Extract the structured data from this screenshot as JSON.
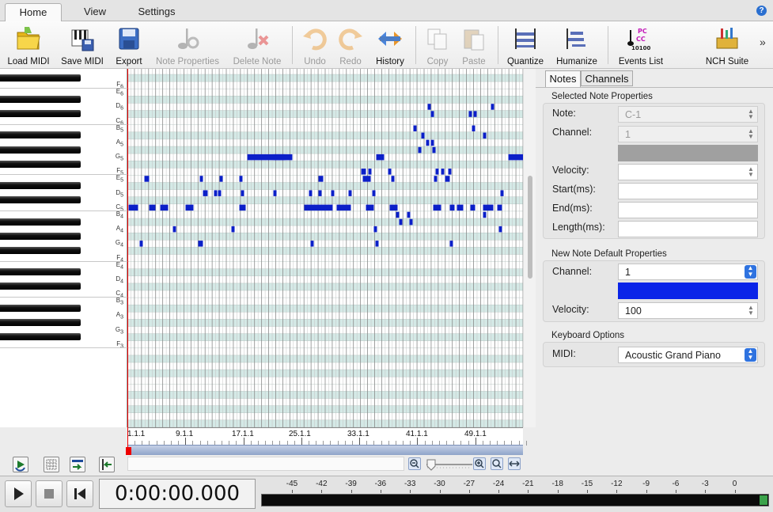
{
  "menu": {
    "tabs": [
      "Home",
      "View",
      "Settings"
    ],
    "help": "?"
  },
  "toolbar": {
    "load_midi": "Load MIDI",
    "save_midi": "Save MIDI",
    "export": "Export",
    "note_properties": "Note Properties",
    "delete_note": "Delete Note",
    "undo": "Undo",
    "redo": "Redo",
    "history": "History",
    "copy": "Copy",
    "paste": "Paste",
    "quantize": "Quantize",
    "humanize": "Humanize",
    "events_list": "Events List",
    "nch_suite": "NCH Suite",
    "more": "»"
  },
  "keyboard": {
    "labels": [
      {
        "note": "F",
        "octave": "6"
      },
      {
        "note": "E",
        "octave": "6"
      },
      {
        "note": "D",
        "octave": "6"
      },
      {
        "note": "C",
        "octave": "6"
      },
      {
        "note": "B",
        "octave": "5"
      },
      {
        "note": "A",
        "octave": "5"
      },
      {
        "note": "G",
        "octave": "5"
      },
      {
        "note": "F",
        "octave": "5"
      },
      {
        "note": "E",
        "octave": "5"
      },
      {
        "note": "D",
        "octave": "5"
      },
      {
        "note": "C",
        "octave": "5"
      },
      {
        "note": "B",
        "octave": "4"
      },
      {
        "note": "A",
        "octave": "4"
      },
      {
        "note": "G",
        "octave": "4"
      },
      {
        "note": "F",
        "octave": "4"
      },
      {
        "note": "E",
        "octave": "4"
      },
      {
        "note": "D",
        "octave": "4"
      },
      {
        "note": "C",
        "octave": "4"
      },
      {
        "note": "B",
        "octave": "3"
      },
      {
        "note": "A",
        "octave": "3"
      },
      {
        "note": "G",
        "octave": "3"
      },
      {
        "note": "F",
        "octave": "3"
      }
    ]
  },
  "ruler": {
    "labels": [
      "1.1.1",
      "9.1.1",
      "17.1.1",
      "25.1.1",
      "33.1.1",
      "41.1.1",
      "49.1.1"
    ]
  },
  "transport": {
    "time": "0:00:00.000",
    "meter_labels": [
      "-45",
      "-42",
      "-39",
      "-36",
      "-33",
      "-30",
      "-27",
      "-24",
      "-21",
      "-18",
      "-15",
      "-12",
      "-9",
      "-6",
      "-3",
      "0"
    ]
  },
  "panel": {
    "tabs": [
      "Notes",
      "Channels"
    ],
    "selected_title": "Selected Note Properties",
    "note_label": "Note:",
    "note_value": "C-1",
    "channel_label": "Channel:",
    "channel_value": "1",
    "velocity_label": "Velocity:",
    "velocity_value": "",
    "start_label": "Start(ms):",
    "start_value": "",
    "end_label": "End(ms):",
    "end_value": "",
    "length_label": "Length(ms):",
    "length_value": "",
    "new_title": "New Note Default Properties",
    "new_channel_label": "Channel:",
    "new_channel_value": "1",
    "new_velocity_label": "Velocity:",
    "new_velocity_value": "100",
    "kbd_title": "Keyboard Options",
    "midi_label": "MIDI:",
    "midi_value": "Acoustic Grand Piano"
  },
  "colors": {
    "note": "#0b1fc8",
    "new_channel_color": "#0a24e8",
    "selected_channel_color": "#a0a0a0",
    "row_shade": "#d4e9e6"
  }
}
